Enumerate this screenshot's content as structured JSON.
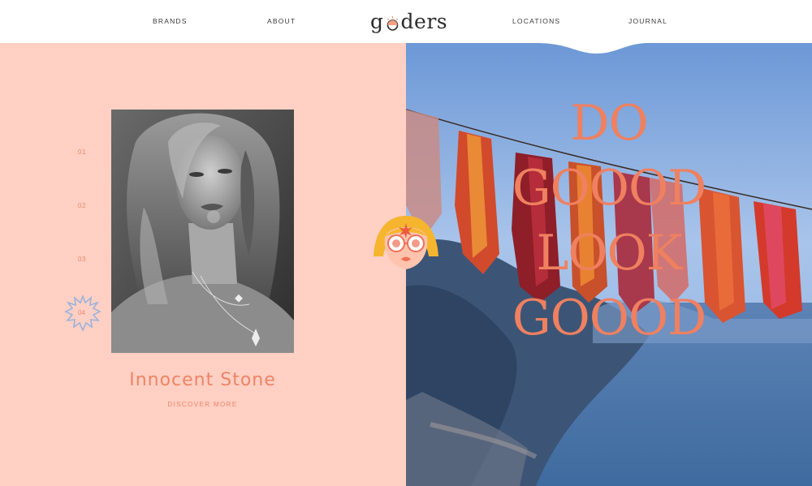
{
  "nav": {
    "brands": "BRANDS",
    "about": "ABOUT",
    "locations": "LOCATIONS",
    "journal": "JOURNAL"
  },
  "logo": {
    "pre": "g",
    "post": "ders"
  },
  "slider": {
    "items": [
      "01",
      "02",
      "03",
      "04"
    ],
    "active_index": 3
  },
  "product": {
    "title": "Innocent Stone",
    "cta": "DISCOVER MORE"
  },
  "hero": {
    "lines": [
      "DO",
      "GOOOD",
      "LOOK",
      "GOOOD"
    ]
  },
  "colors": {
    "accent": "#ee8468",
    "panel": "#ffd0c3",
    "burst": "#9bb3dc"
  }
}
